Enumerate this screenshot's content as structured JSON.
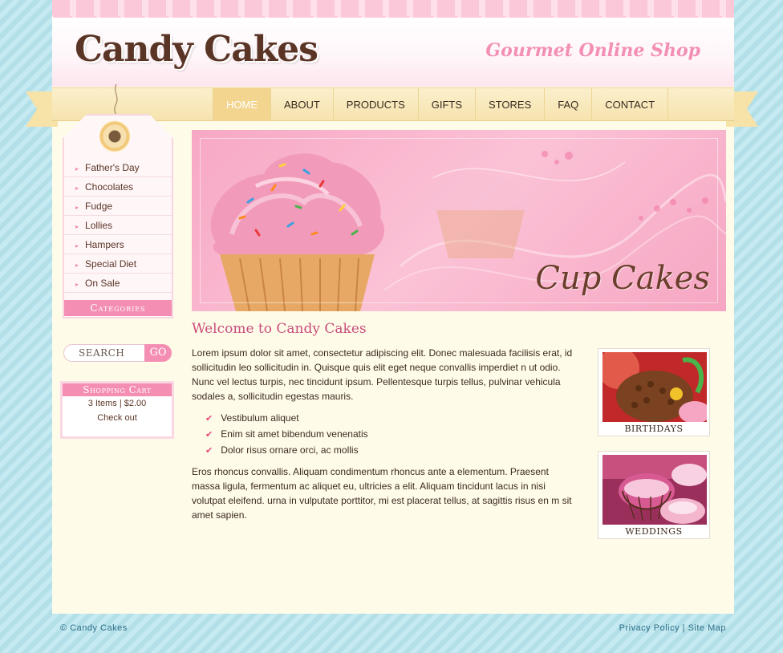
{
  "site": {
    "logo": "Candy Cakes",
    "tagline": "Gourmet Online Shop"
  },
  "nav": {
    "items": [
      {
        "label": "HOME",
        "active": true
      },
      {
        "label": "ABOUT",
        "active": false
      },
      {
        "label": "PRODUCTS",
        "active": false
      },
      {
        "label": "GIFTS",
        "active": false
      },
      {
        "label": "STORES",
        "active": false
      },
      {
        "label": "FAQ",
        "active": false
      },
      {
        "label": "CONTACT",
        "active": false
      }
    ]
  },
  "sidebar": {
    "categories": [
      "Father's Day",
      "Chocolates",
      "Fudge",
      "Lollies",
      "Hampers",
      "Special Diet",
      "On Sale"
    ],
    "categories_label": "Categories",
    "search_placeholder": "SEARCH",
    "search_button": "GO",
    "cart": {
      "title": "Shopping Cart",
      "summary": "3 Items | $2.00",
      "checkout": "Check out"
    }
  },
  "banner": {
    "title": "Cup Cakes"
  },
  "main": {
    "heading": "Welcome to Candy Cakes",
    "para1": "Lorem ipsum dolor sit amet, consectetur adipiscing elit. Donec malesuada facilisis erat, id sollicitudin leo sollicitudin in. Quisque quis elit eget neque convallis imperdiet n ut odio. Nunc vel lectus turpis, nec tincidunt ipsum. Pellentesque turpis tellus, pulvinar vehicula sodales a, sollicitudin egestas mauris.",
    "bullets": [
      "Vestibulum aliquet",
      "Enim sit amet bibendum venenatis",
      "Dolor risus ornare orci, ac mollis"
    ],
    "para2": "Eros rhoncus convallis. Aliquam condimentum rhoncus ante a elementum. Praesent massa ligula, fermentum ac aliquet eu, ultricies a elit. Aliquam tincidunt lacus in nisi volutpat eleifend. urna in vulputate porttitor, mi est placerat tellus, at sagittis risus en m sit amet sapien."
  },
  "thumbnails": [
    {
      "caption": "BIRTHDAYS"
    },
    {
      "caption": "WEDDINGS"
    }
  ],
  "footer": {
    "copyright": "© Candy Cakes",
    "privacy": "Privacy Policy",
    "separator": "|",
    "sitemap": "Site Map"
  },
  "colors": {
    "accent_pink": "#f48fb3",
    "heading_pink": "#c94d7c",
    "brown": "#5a3526",
    "nav_active": "#f3d58f",
    "footer_link": "#2c6f86"
  }
}
